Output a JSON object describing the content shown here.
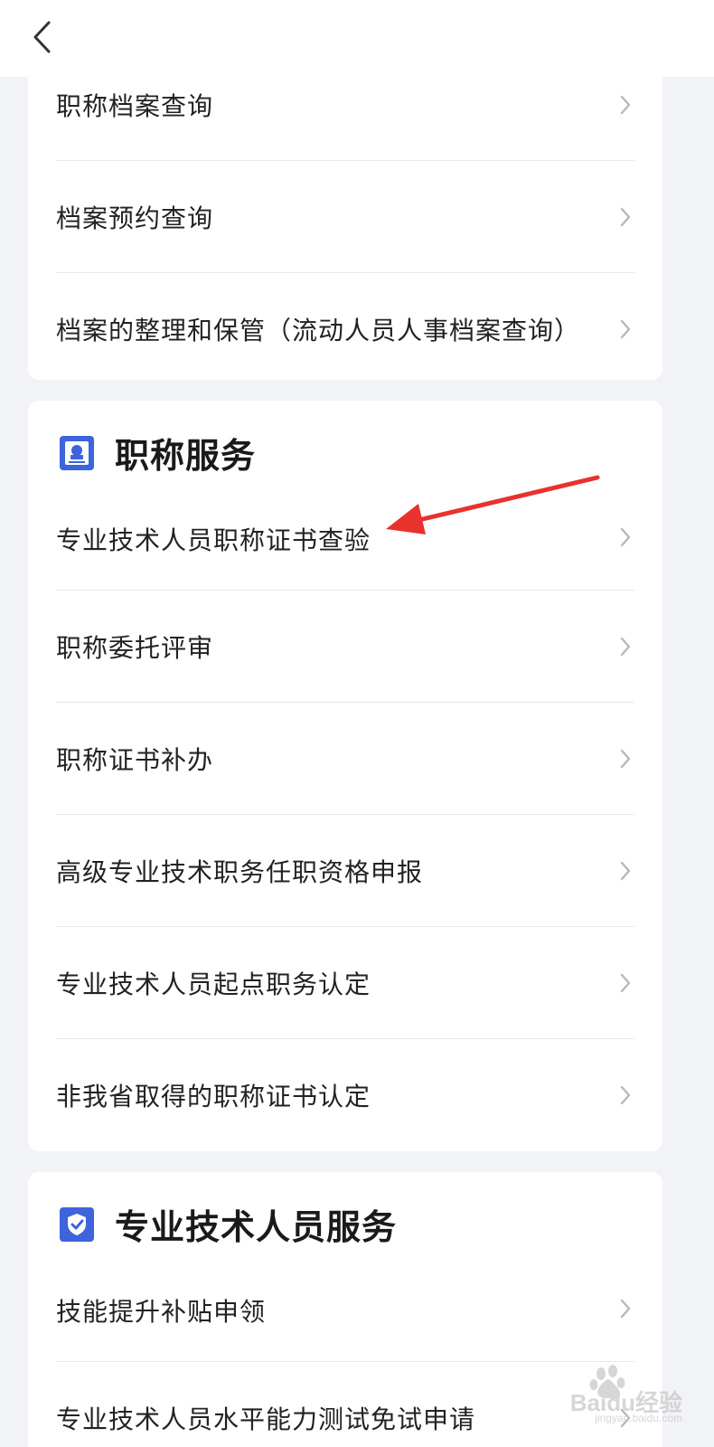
{
  "nav": {
    "back_icon": "chevron-left-icon"
  },
  "section_archive": {
    "items": [
      {
        "label": "职称档案查询"
      },
      {
        "label": "档案预约查询"
      },
      {
        "label": "档案的整理和保管（流动人员人事档案查询）"
      }
    ]
  },
  "section_title_services": {
    "title": "职称服务",
    "icon": "certificate-badge-icon",
    "items": [
      {
        "label": "专业技术人员职称证书查验"
      },
      {
        "label": "职称委托评审"
      },
      {
        "label": "职称证书补办"
      },
      {
        "label": "高级专业技术职务任职资格申报"
      },
      {
        "label": "专业技术人员起点职务认定"
      },
      {
        "label": "非我省取得的职称证书认定"
      }
    ]
  },
  "section_professional_services": {
    "title": "专业技术人员服务",
    "icon": "verified-shield-icon",
    "items": [
      {
        "label": "技能提升补贴申领"
      },
      {
        "label": "专业技术人员水平能力测试免试申请"
      }
    ]
  },
  "watermark": {
    "brand": "Baidu经验",
    "url": "jingyan.baidu.com"
  },
  "colors": {
    "accent": "#3d63dd",
    "annotation": "#e8322e",
    "background": "#f2f3f7"
  }
}
